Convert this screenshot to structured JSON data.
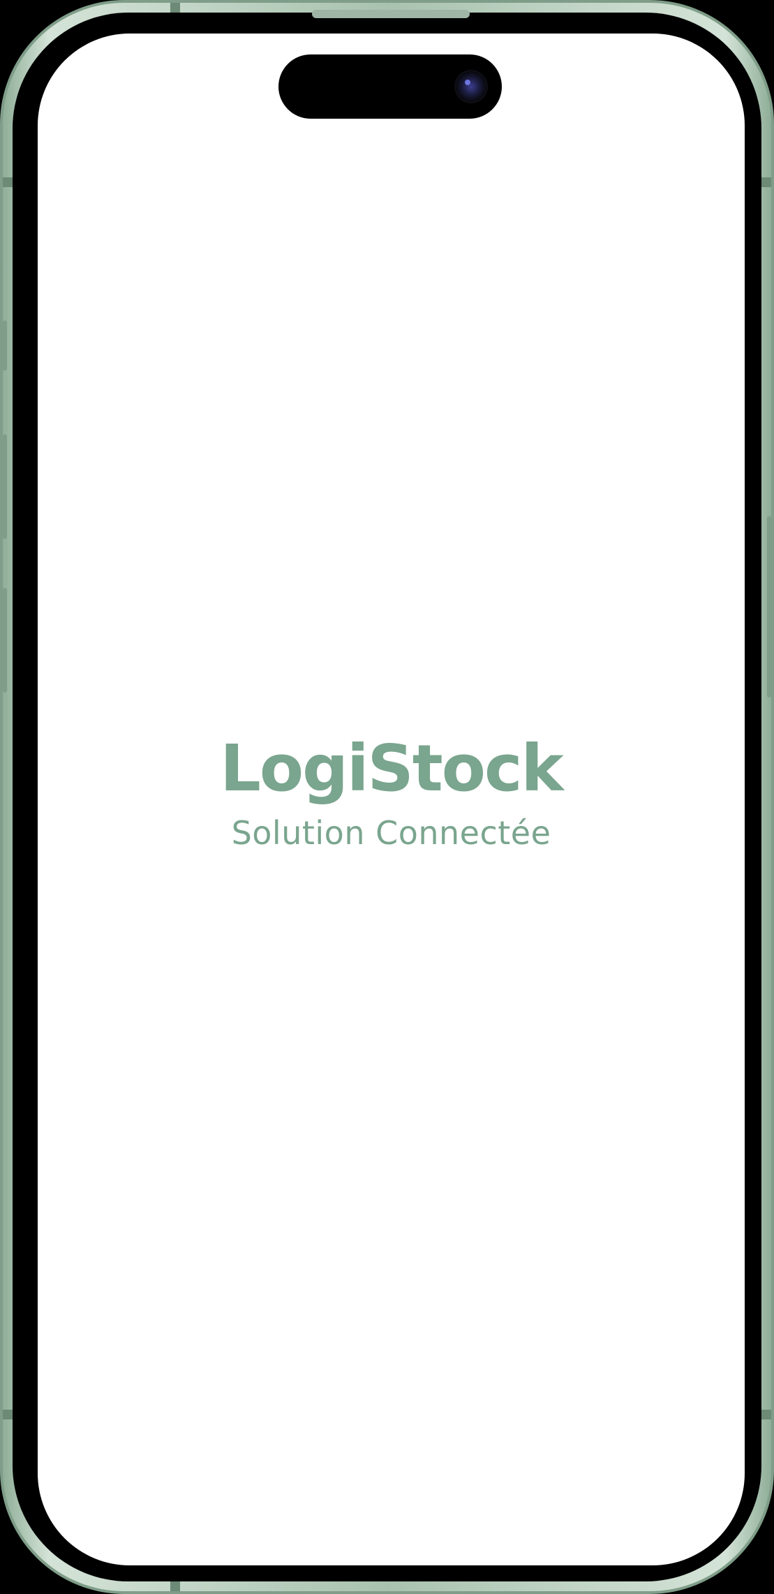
{
  "splash": {
    "title": "LogiStock",
    "subtitle": "Solution Connectée"
  },
  "colors": {
    "brand": "#7aa58e",
    "screen_background": "#ffffff",
    "device_frame": "#a9c2af"
  },
  "icons": {
    "camera": "camera-lens-icon"
  }
}
